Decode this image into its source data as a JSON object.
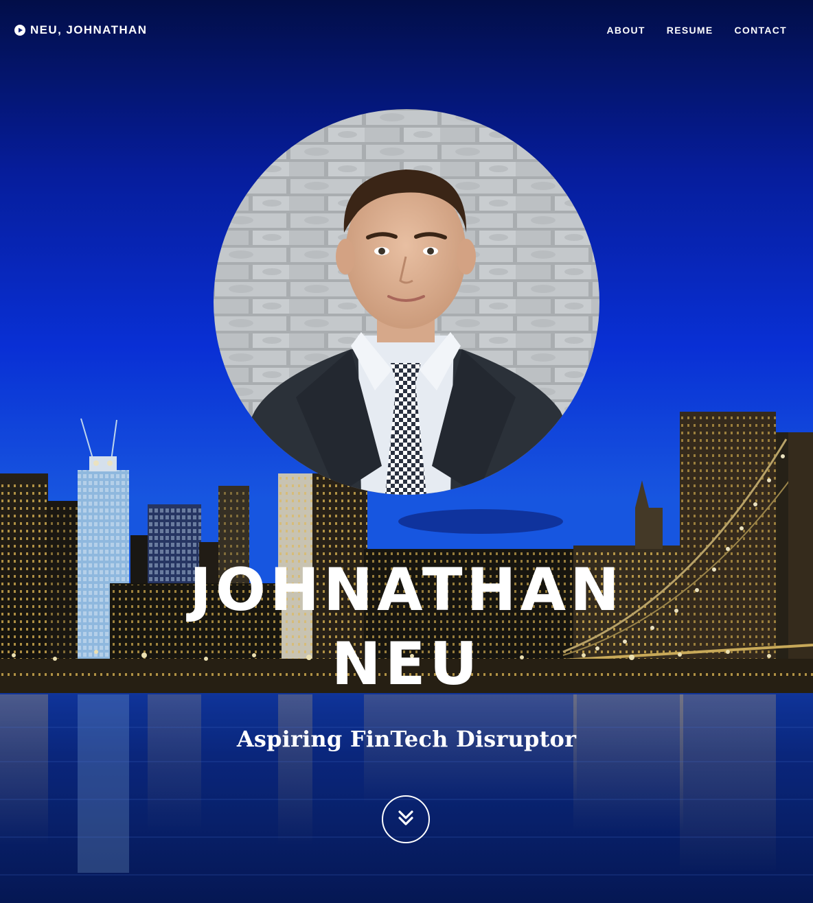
{
  "navbar": {
    "brand_label": "NEU, JOHNATHAN",
    "brand_icon": "play-circle-icon",
    "links": [
      {
        "label": "ABOUT"
      },
      {
        "label": "RESUME"
      },
      {
        "label": "CONTACT"
      }
    ]
  },
  "hero": {
    "name_line1": "JOHNATHAN",
    "name_line2": "NEU",
    "tagline": "Aspiring FinTech Disruptor",
    "scroll_icon": "double-chevron-down-icon",
    "profile_photo_icon": "profile-photo",
    "background_image": "city-skyline-night"
  },
  "colors": {
    "text": "#ffffff",
    "sky_top": "#020a3a",
    "sky_mid": "#0a2bd4",
    "water": "#0b1f6a"
  }
}
